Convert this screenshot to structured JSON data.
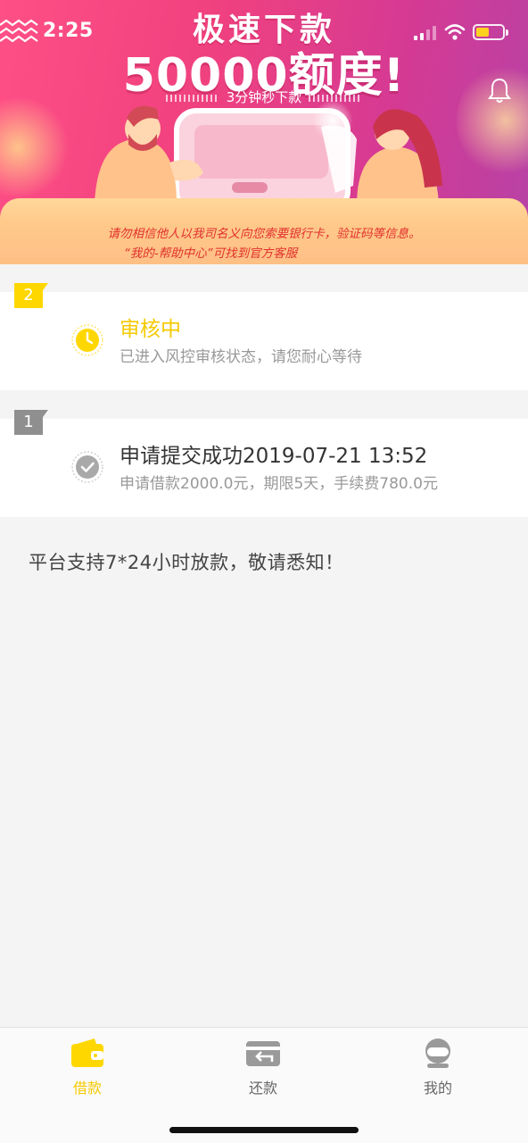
{
  "status_bar": {
    "time": "2:25"
  },
  "banner": {
    "headline_line1": "极速下款",
    "headline_line2": "50000额度!",
    "subheadline": "3分钟秒下款",
    "warning_line1": "请勿相信他人以我司名义向您索要银行卡，验证码等信息。",
    "warning_line2": "“我的-帮助中心”可找到官方客服",
    "bell_icon": "bell-icon"
  },
  "steps": [
    {
      "number": "2",
      "title": "审核中",
      "description": "已进入风控审核状态，请您耐心等待",
      "icon": "clock-icon",
      "color": "#ffd700"
    },
    {
      "number": "1",
      "title": "申请提交成功2019-07-21 13:52",
      "description": "申请借款2000.0元，期限5天，手续费780.0元",
      "icon": "checkmark-icon",
      "color": "#8f8f8f"
    }
  ],
  "notice": "平台支持7*24小时放款，敬请悉知！",
  "tabbar": {
    "items": [
      {
        "label": "借款",
        "icon": "wallet-icon",
        "active": true
      },
      {
        "label": "还款",
        "icon": "card-return-icon",
        "active": false
      },
      {
        "label": "我的",
        "icon": "user-icon",
        "active": false
      }
    ],
    "active_color": "#f5c900"
  }
}
